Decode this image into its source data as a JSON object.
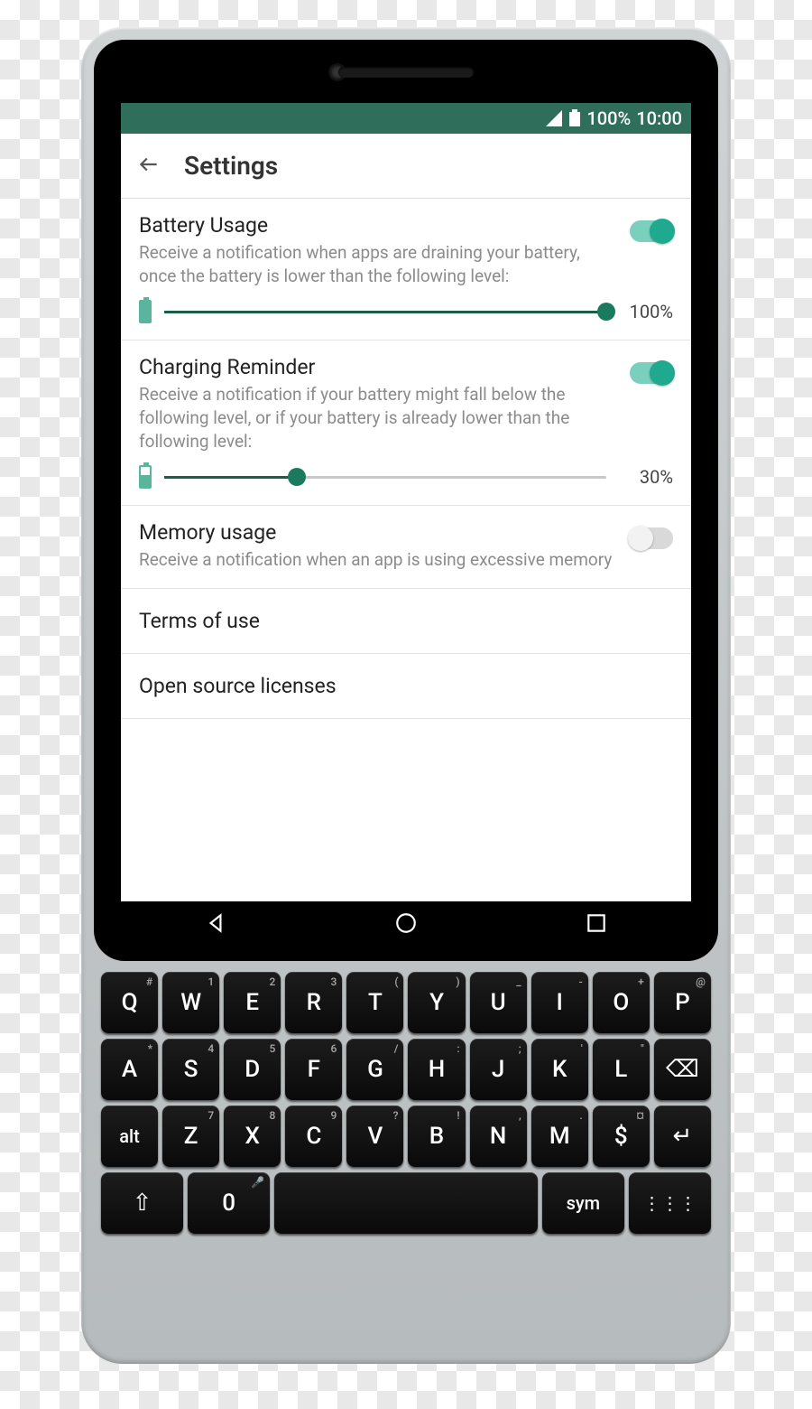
{
  "status": {
    "battery_pct": "100%",
    "time": "10:00"
  },
  "header": {
    "title": "Settings"
  },
  "settings": {
    "battery_usage": {
      "title": "Battery Usage",
      "desc": "Receive a notification when apps are draining your battery, once the battery is lower than the following level:",
      "enabled": true,
      "slider_pct": 100,
      "slider_label": "100%"
    },
    "charging": {
      "title": "Charging Reminder",
      "desc": "Receive a notification if your battery might fall below the following level, or if your battery is already lower than the following level:",
      "enabled": true,
      "slider_pct": 30,
      "slider_label": "30%"
    },
    "memory": {
      "title": "Memory usage",
      "desc": "Receive a notification when an app is using excessive memory",
      "enabled": false
    },
    "terms": {
      "title": "Terms of use"
    },
    "oss": {
      "title": "Open source licenses"
    }
  },
  "keyboard": {
    "row1": [
      {
        "main": "Q",
        "sup": "#"
      },
      {
        "main": "W",
        "sup": "1"
      },
      {
        "main": "E",
        "sup": "2"
      },
      {
        "main": "R",
        "sup": "3"
      },
      {
        "main": "T",
        "sup": "("
      },
      {
        "main": "Y",
        "sup": ")"
      },
      {
        "main": "U",
        "sup": "_"
      },
      {
        "main": "I",
        "sup": "-"
      },
      {
        "main": "O",
        "sup": "+"
      },
      {
        "main": "P",
        "sup": "@"
      }
    ],
    "row2": [
      {
        "main": "A",
        "sup": "*"
      },
      {
        "main": "S",
        "sup": "4"
      },
      {
        "main": "D",
        "sup": "5"
      },
      {
        "main": "F",
        "sup": "6"
      },
      {
        "main": "G",
        "sup": "/"
      },
      {
        "main": "H",
        "sup": ":"
      },
      {
        "main": "J",
        "sup": ";"
      },
      {
        "main": "K",
        "sup": "'"
      },
      {
        "main": "L",
        "sup": "\""
      },
      {
        "main": "⌫",
        "sup": ""
      }
    ],
    "row3": [
      {
        "main": "alt",
        "sup": ""
      },
      {
        "main": "Z",
        "sup": "7"
      },
      {
        "main": "X",
        "sup": "8"
      },
      {
        "main": "C",
        "sup": "9"
      },
      {
        "main": "V",
        "sup": "?"
      },
      {
        "main": "B",
        "sup": "!"
      },
      {
        "main": "N",
        "sup": ","
      },
      {
        "main": "M",
        "sup": "."
      },
      {
        "main": "$",
        "sup": "¤"
      },
      {
        "main": "↵",
        "sup": ""
      }
    ],
    "row4": [
      {
        "main": "⇧",
        "sup": ""
      },
      {
        "main": "0",
        "sup": "🎤"
      },
      {
        "main": "",
        "sup": ""
      },
      {
        "main": "sym",
        "sup": ""
      },
      {
        "main": "⋮⋮⋮",
        "sup": ""
      }
    ]
  }
}
